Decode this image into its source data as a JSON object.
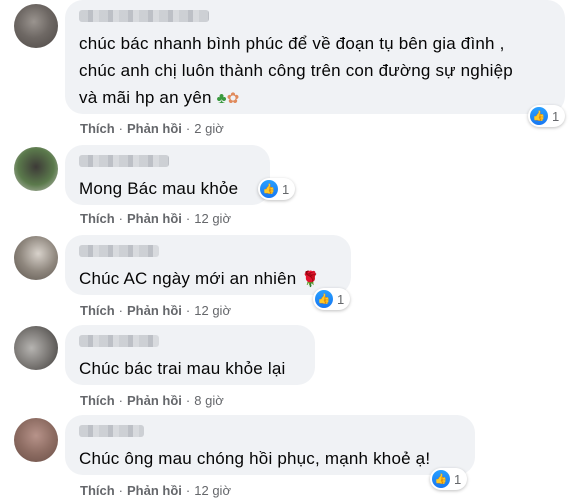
{
  "comments": [
    {
      "lines": [
        "chúc bác nhanh bình phúc để về đoạn tụ bên gia đình ,",
        "chúc anh chị luôn thành công trên con đường sự nghiệp",
        "và mãi hp an yên"
      ],
      "emojis": [
        "clover",
        "flower"
      ],
      "reaction": {
        "icon": "like-icon",
        "count": "1"
      },
      "actions": {
        "like": "Thích",
        "reply": "Phản hồi",
        "time": "2 giờ"
      }
    },
    {
      "lines": [
        "Mong Bác mau khỏe"
      ],
      "reaction": {
        "icon": "like-icon",
        "count": "1"
      },
      "actions": {
        "like": "Thích",
        "reply": "Phản hồi",
        "time": "12 giờ"
      }
    },
    {
      "lines": [
        "Chúc AC ngày mới an nhiên"
      ],
      "emojis": [
        "rose"
      ],
      "reaction": {
        "icon": "like-icon",
        "count": "1"
      },
      "actions": {
        "like": "Thích",
        "reply": "Phản hồi",
        "time": "12 giờ"
      }
    },
    {
      "lines": [
        "Chúc bác trai mau khỏe lại"
      ],
      "actions": {
        "like": "Thích",
        "reply": "Phản hồi",
        "time": "8 giờ"
      }
    },
    {
      "lines": [
        "Chúc ông mau chóng hồi phục, mạnh khoẻ ạ!"
      ],
      "reaction": {
        "icon": "like-icon",
        "count": "1"
      },
      "actions": {
        "like": "Thích",
        "reply": "Phản hồi",
        "time": "12 giờ"
      }
    }
  ],
  "colors": {
    "like_blue": "#1877f2",
    "bubble": "#f0f2f5",
    "meta_text": "#65676b"
  }
}
